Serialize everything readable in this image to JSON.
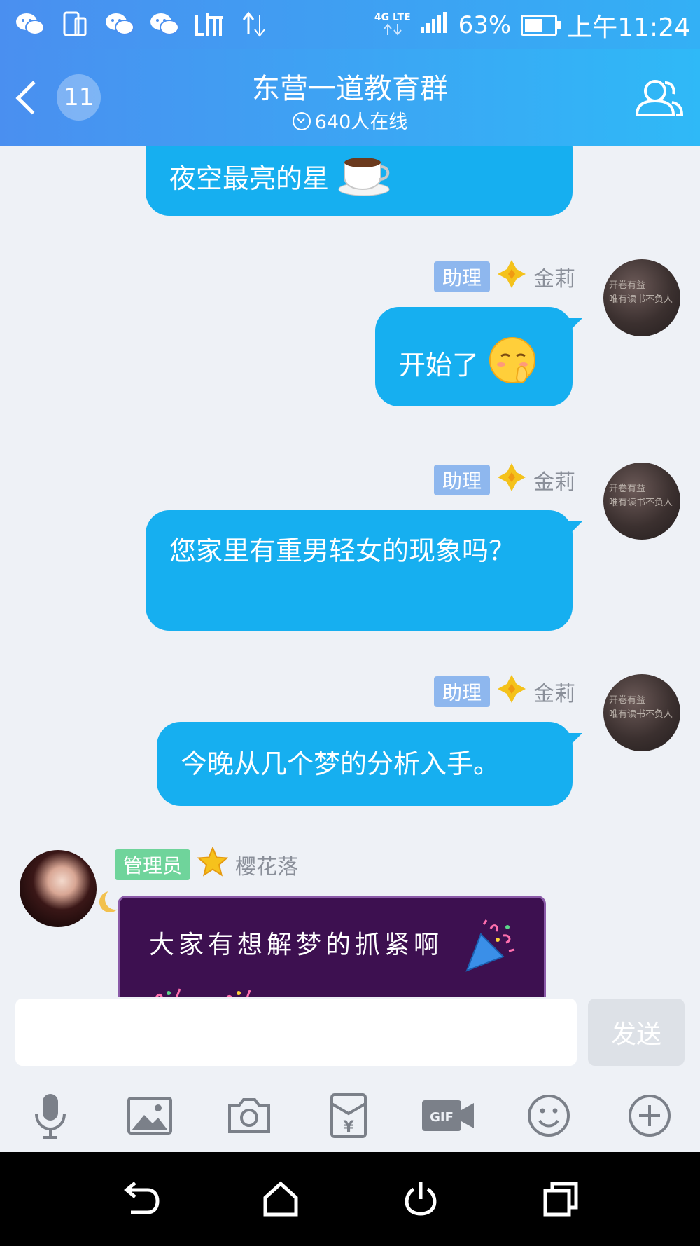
{
  "status_bar": {
    "network": "4G LTE",
    "battery_percent": "63%",
    "battery_level": 0.63,
    "time": "上午11:24",
    "left_icons": [
      "wechat-icon",
      "phone-tablet-icon",
      "wechat-icon",
      "wechat-icon",
      "listen-app-icon",
      "data-transfer-icon"
    ]
  },
  "header": {
    "unread_count": "11",
    "title": "东营一道教育群",
    "online": "640人在线"
  },
  "messages": [
    {
      "side": "right",
      "text": "夜空最亮的星",
      "emoji": "coffee-emoji"
    },
    {
      "side": "right",
      "role": "助理",
      "sender": "金莉",
      "text": "开始了",
      "emoji": "shy-face-emoji"
    },
    {
      "side": "right",
      "role": "助理",
      "sender": "金莉",
      "text": "您家里有重男轻女的现象吗？"
    },
    {
      "side": "right",
      "role": "助理",
      "sender": "金莉",
      "text": "今晚从几个梦的分析入手。"
    },
    {
      "side": "left",
      "role": "管理员",
      "sender": "樱花落",
      "card_text": "大家有想解梦的抓紧啊"
    }
  ],
  "avatar_text": {
    "line1": "开卷有益",
    "line2": "唯有读书不负人"
  },
  "input": {
    "placeholder": "",
    "send_label": "发送"
  },
  "toolbar": [
    "microphone-icon",
    "image-icon",
    "camera-icon",
    "red-packet-icon",
    "gif-icon",
    "emoji-icon",
    "plus-icon"
  ],
  "toolbar_labels": {
    "gif": "GIF",
    "red_packet": "¥"
  },
  "colors": {
    "header_start": "#4a8ff0",
    "header_end": "#2fb9f7",
    "bubble": "#16aff0",
    "assistant_tag": "#8eb7ee",
    "admin_tag": "#6fd49b"
  }
}
